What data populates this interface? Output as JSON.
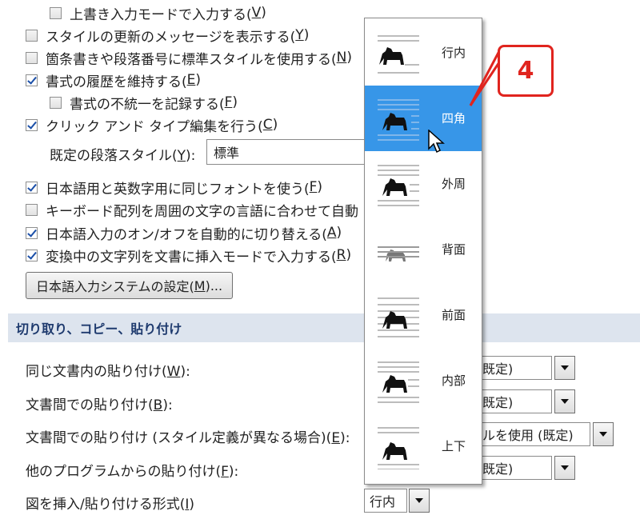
{
  "editing_options": [
    {
      "key": "overtype",
      "checked": false,
      "text": "上書き入力モードで入力する(",
      "mnemonic": "V",
      "suffix": ")"
    },
    {
      "key": "style_update_msg",
      "checked": false,
      "text": "スタイルの更新のメッセージを表示する(",
      "mnemonic": "Y",
      "suffix": ")"
    },
    {
      "key": "normal_style_bullets",
      "checked": false,
      "text": "箇条書きや段落番号に標準スタイルを使用する(",
      "mnemonic": "N",
      "suffix": ")"
    },
    {
      "key": "keep_format_history",
      "checked": true,
      "text": "書式の履歴を維持する(",
      "mnemonic": "E",
      "suffix": ")"
    },
    {
      "key": "mark_inconsistencies",
      "checked": false,
      "text": "書式の不統一を記録する(",
      "mnemonic": "F",
      "suffix": ")"
    },
    {
      "key": "click_and_type",
      "checked": true,
      "text": "クリック アンド タイプ編集を行う(",
      "mnemonic": "C",
      "suffix": ")"
    }
  ],
  "default_paragraph_style": {
    "label": "既定の段落スタイル(",
    "mnemonic": "Y",
    "suffix": "):",
    "value": "標準"
  },
  "ime_options": [
    {
      "key": "same_font",
      "checked": true,
      "text": "日本語用と英数字用に同じフォントを使う(",
      "mnemonic": "F",
      "suffix": ")"
    },
    {
      "key": "keyboard_match",
      "checked": false,
      "text": "キーボード配列を周囲の文字の言語に合わせて自動",
      "mnemonic": "",
      "suffix": ""
    },
    {
      "key": "ime_auto_toggle",
      "checked": true,
      "text": "日本語入力のオン/オフを自動的に切り替える(",
      "mnemonic": "A",
      "suffix": ")"
    },
    {
      "key": "insert_mode_convert",
      "checked": true,
      "text": "変換中の文字列を文書に挿入モードで入力する(",
      "mnemonic": "R",
      "suffix": ")"
    }
  ],
  "ime_settings_button": {
    "text": "日本語入力システムの設定(",
    "mnemonic": "M",
    "suffix": ")..."
  },
  "section_title": "切り取り、コピー、貼り付け",
  "paste_options": [
    {
      "label": "同じ文書内の貼り付け(",
      "mnemonic": "W",
      "suffix": "):",
      "value": "既定)"
    },
    {
      "label": "文書間での貼り付け(",
      "mnemonic": "B",
      "suffix": "):",
      "value": "既定)"
    },
    {
      "label": "文書間での貼り付け (スタイル定義が異なる場合)(",
      "mnemonic": "E",
      "suffix": "):",
      "value": "ルを使用 (既定)"
    },
    {
      "label": "他のプログラムからの貼り付け(",
      "mnemonic": "F",
      "suffix": "):",
      "value": "既定)"
    },
    {
      "label": "図を挿入/貼り付ける形式(",
      "mnemonic": "I",
      "suffix": ")",
      "value": "行内"
    }
  ],
  "wrap_dropdown": {
    "selected_index": 1,
    "items": [
      {
        "label": "行内",
        "icon": "wrap-inline-icon"
      },
      {
        "label": "四角",
        "icon": "wrap-square-icon"
      },
      {
        "label": "外周",
        "icon": "wrap-tight-icon"
      },
      {
        "label": "背面",
        "icon": "wrap-behind-text-icon"
      },
      {
        "label": "前面",
        "icon": "wrap-in-front-icon"
      },
      {
        "label": "内部",
        "icon": "wrap-through-icon"
      },
      {
        "label": "上下",
        "icon": "wrap-top-bottom-icon"
      }
    ]
  },
  "callout_step": "4",
  "colors": {
    "accent": "#3796e8",
    "section_bg": "#dde4ee",
    "callout": "#e0241e"
  }
}
